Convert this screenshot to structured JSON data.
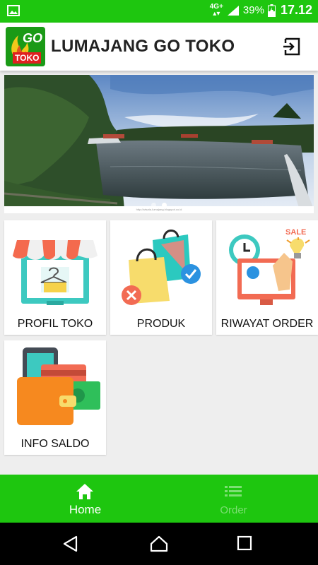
{
  "status_bar": {
    "network": "4G+",
    "battery": "39%",
    "time": "17.12"
  },
  "app_bar": {
    "logo": {
      "word1": "GO",
      "word2": "TOKO"
    },
    "title": "LUMAJANG GO TOKO",
    "logout_icon": "logout-icon"
  },
  "banner": {
    "caption": "http://wisata-lumajang.blogspot.co.id",
    "slide_count": 2,
    "active_slide": 2
  },
  "menu": [
    {
      "label": "PROFIL TOKO",
      "icon": "store-icon"
    },
    {
      "label": "PRODUK",
      "icon": "shopping-bags-icon"
    },
    {
      "label": "RIWAYAT ORDER",
      "icon": "order-history-icon"
    },
    {
      "label": "INFO SALDO",
      "icon": "wallet-icon"
    }
  ],
  "bottom_nav": {
    "home_label": "Home",
    "order_label": "Order",
    "active": "Home"
  },
  "history_icon_text": "SALE",
  "colors": {
    "brand_green": "#1ec60f",
    "inactive_nav": "#7ddf74"
  }
}
